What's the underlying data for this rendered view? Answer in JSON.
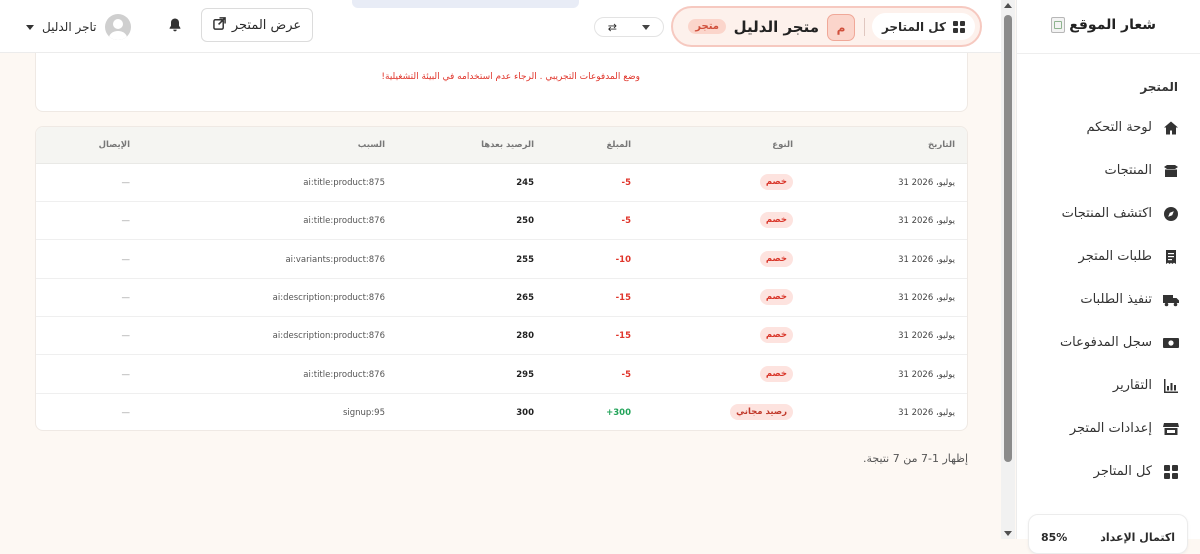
{
  "sidebar": {
    "logo_text": "شعار الموقع",
    "section_title": "المتجر",
    "items": [
      {
        "label": "لوحة التحكم",
        "icon": "home-icon"
      },
      {
        "label": "المنتجات",
        "icon": "box-icon"
      },
      {
        "label": "اكتشف المنتجات",
        "icon": "compass-icon"
      },
      {
        "label": "طلبات المتجر",
        "icon": "receipt-icon"
      },
      {
        "label": "تنفيذ الطلبات",
        "icon": "truck-icon"
      },
      {
        "label": "سجل المدفوعات",
        "icon": "money-icon"
      },
      {
        "label": "التقارير",
        "icon": "chart-icon"
      },
      {
        "label": "إعدادات المتجر",
        "icon": "store-icon"
      },
      {
        "label": "كل المتاجر",
        "icon": "grid-icon"
      }
    ],
    "setup": {
      "label": "اكتمال الإعداد",
      "percent": "85%"
    }
  },
  "header": {
    "user_name": "تاجر الدليل",
    "view_store_label": "عرض المتجر",
    "all_stores_label": "كل المتاجر",
    "store_initial": "م",
    "store_name": "متجر الدليل",
    "store_badge": "متجر"
  },
  "notice": {
    "text": "وضع المدفوعات التجريبي . الرجاء عدم استخدامه في البيئة التشغيلية!"
  },
  "table": {
    "headers": {
      "date": "التاريخ",
      "type": "النوع",
      "amount": "المبلغ",
      "balance": "الرصيد بعدها",
      "reason": "السبب",
      "receipt": "الإيصال"
    },
    "rows": [
      {
        "date": "31 يوليو، 2026",
        "type": "خصم",
        "amount": "-5",
        "balance": "245",
        "reason": "ai:title:product:875",
        "receipt": "—"
      },
      {
        "date": "31 يوليو، 2026",
        "type": "خصم",
        "amount": "-5",
        "balance": "250",
        "reason": "ai:title:product:876",
        "receipt": "—"
      },
      {
        "date": "31 يوليو، 2026",
        "type": "خصم",
        "amount": "-10",
        "balance": "255",
        "reason": "ai:variants:product:876",
        "receipt": "—"
      },
      {
        "date": "31 يوليو، 2026",
        "type": "خصم",
        "amount": "-15",
        "balance": "265",
        "reason": "ai:description:product:876",
        "receipt": "—"
      },
      {
        "date": "31 يوليو، 2026",
        "type": "خصم",
        "amount": "-15",
        "balance": "280",
        "reason": "ai:description:product:876",
        "receipt": "—"
      },
      {
        "date": "31 يوليو، 2026",
        "type": "خصم",
        "amount": "-5",
        "balance": "295",
        "reason": "ai:title:product:876",
        "receipt": "—"
      },
      {
        "date": "31 يوليو، 2026",
        "type": "رصيد مجاني",
        "amount": "+300",
        "balance": "300",
        "reason": "signup:95",
        "receipt": "—"
      }
    ]
  },
  "pagination": {
    "text": "إظهار 1-7 من 7 نتيجة."
  },
  "colors": {
    "accent_red": "#e0352b",
    "positive_green": "#23a45a",
    "pill_bg": "#fdf1ec",
    "page_bg": "#fdf8f3"
  }
}
